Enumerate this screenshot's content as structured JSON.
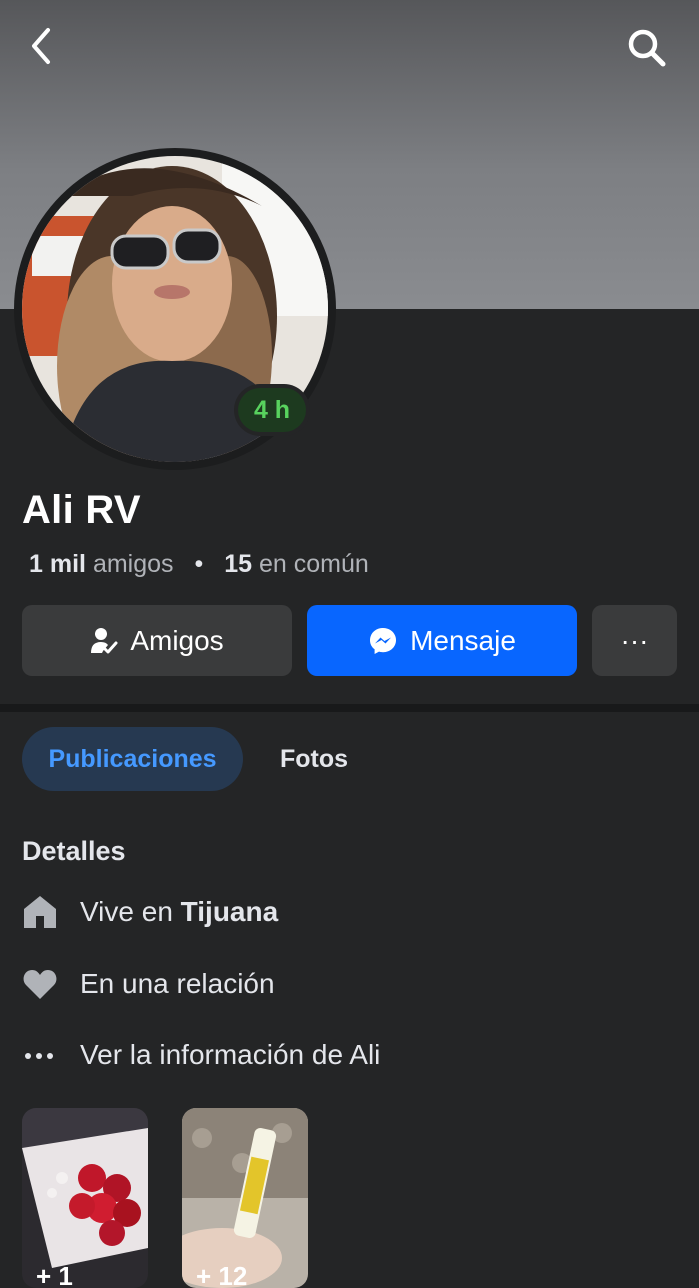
{
  "header": {
    "back_icon": "chevron-left-icon",
    "search_icon": "search-icon"
  },
  "profile": {
    "name": "Ali RV",
    "active_badge": "4 h",
    "friends_count": "1 mil",
    "friends_label": "amigos",
    "mutual_count": "15",
    "mutual_label": "en común"
  },
  "actions": {
    "friends_label": "Amigos",
    "message_label": "Mensaje",
    "more_label": "···"
  },
  "tabs": [
    {
      "label": "Publicaciones",
      "active": true
    },
    {
      "label": "Fotos",
      "active": false
    }
  ],
  "details": {
    "title": "Detalles",
    "lives_prefix": "Vive en",
    "lives_city": "Tijuana",
    "relationship": "En una relación",
    "see_info": "Ver la información de Ali"
  },
  "thumbnails": [
    {
      "count": "+ 1"
    },
    {
      "count": "+ 12"
    }
  ],
  "colors": {
    "background": "#242526",
    "accent": "#0866ff",
    "tab_active_bg": "#263951",
    "tab_active_text": "#4599ff",
    "active_badge": "#58d25e"
  }
}
